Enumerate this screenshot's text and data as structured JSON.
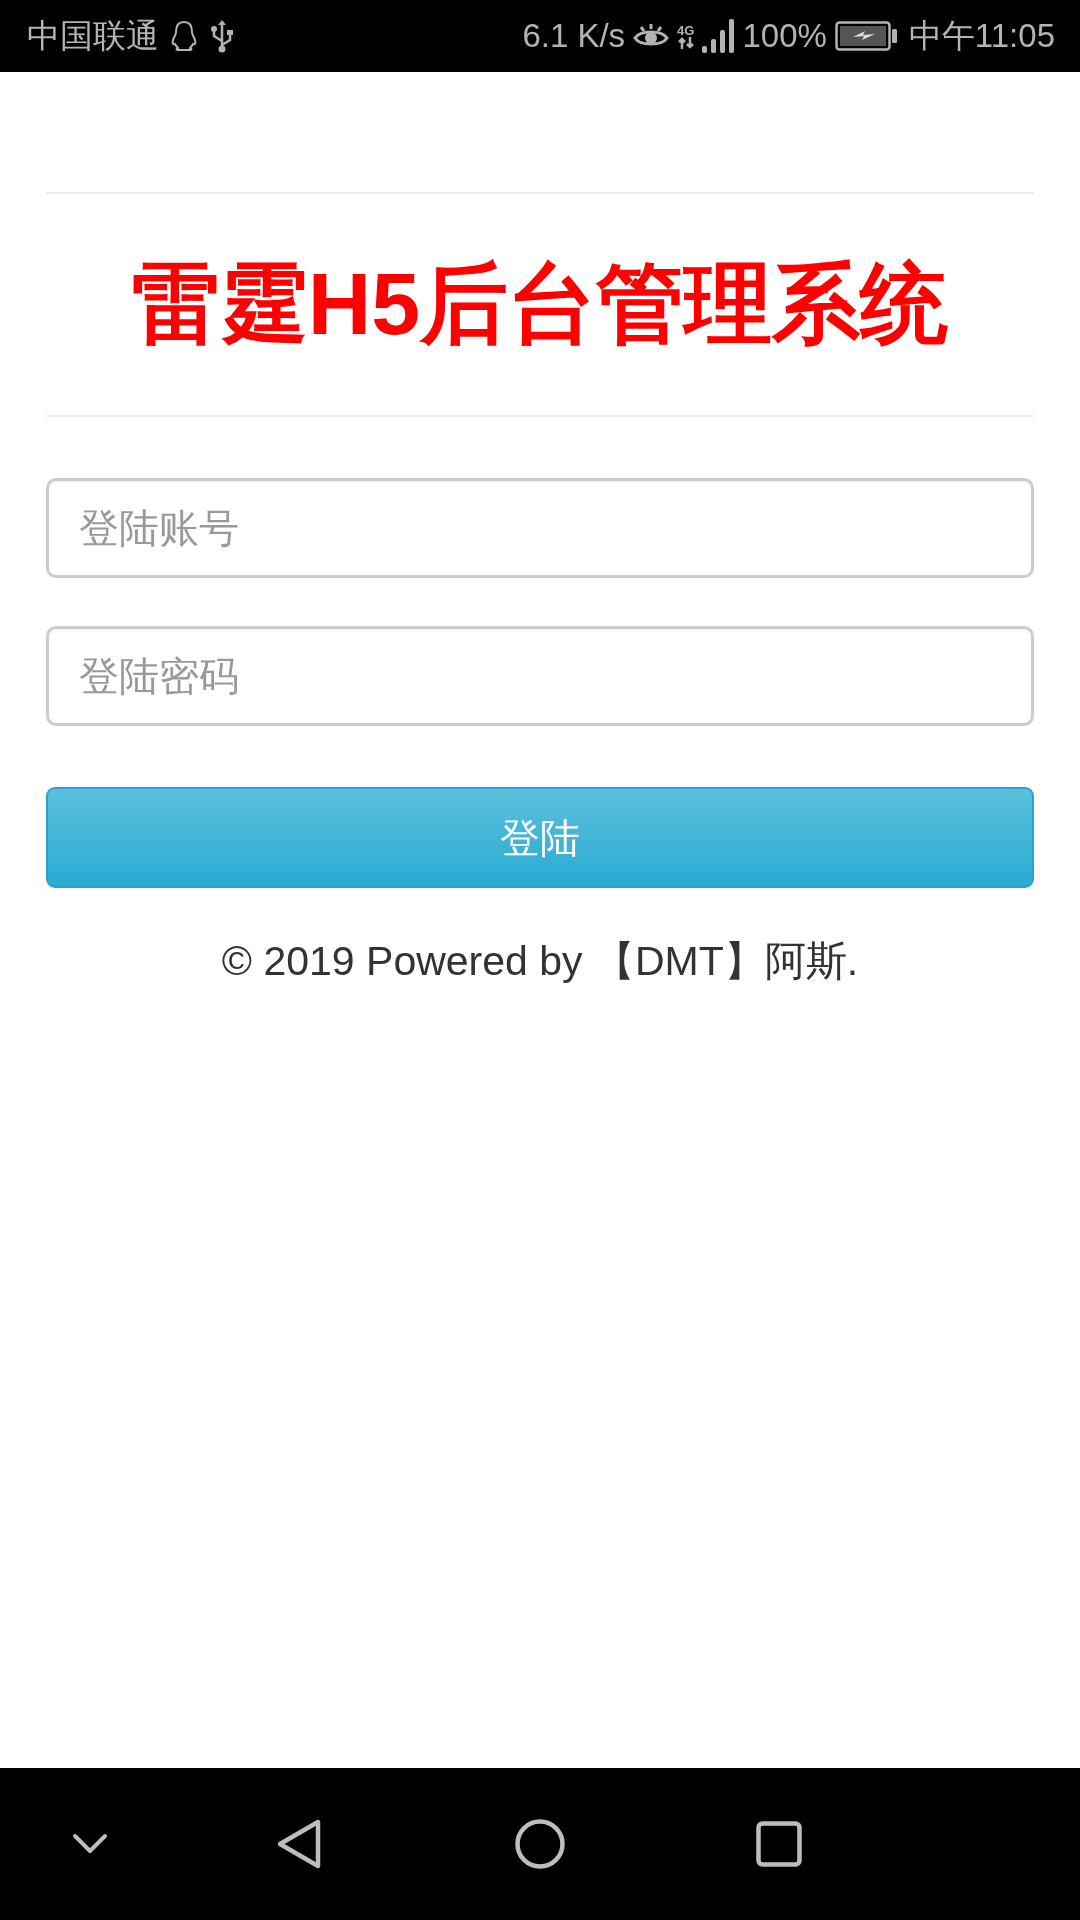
{
  "status_bar": {
    "carrier": "中国联通",
    "speed": "6.1 K/s",
    "network": "4G",
    "battery": "100%",
    "time": "中午11:05"
  },
  "title": "雷霆H5后台管理系统",
  "fields": [
    {
      "placeholder": "登陆账号"
    },
    {
      "placeholder": "登陆密码"
    }
  ],
  "login_button": "登陆",
  "footer": "© 2019 Powered by 【DMT】阿斯."
}
